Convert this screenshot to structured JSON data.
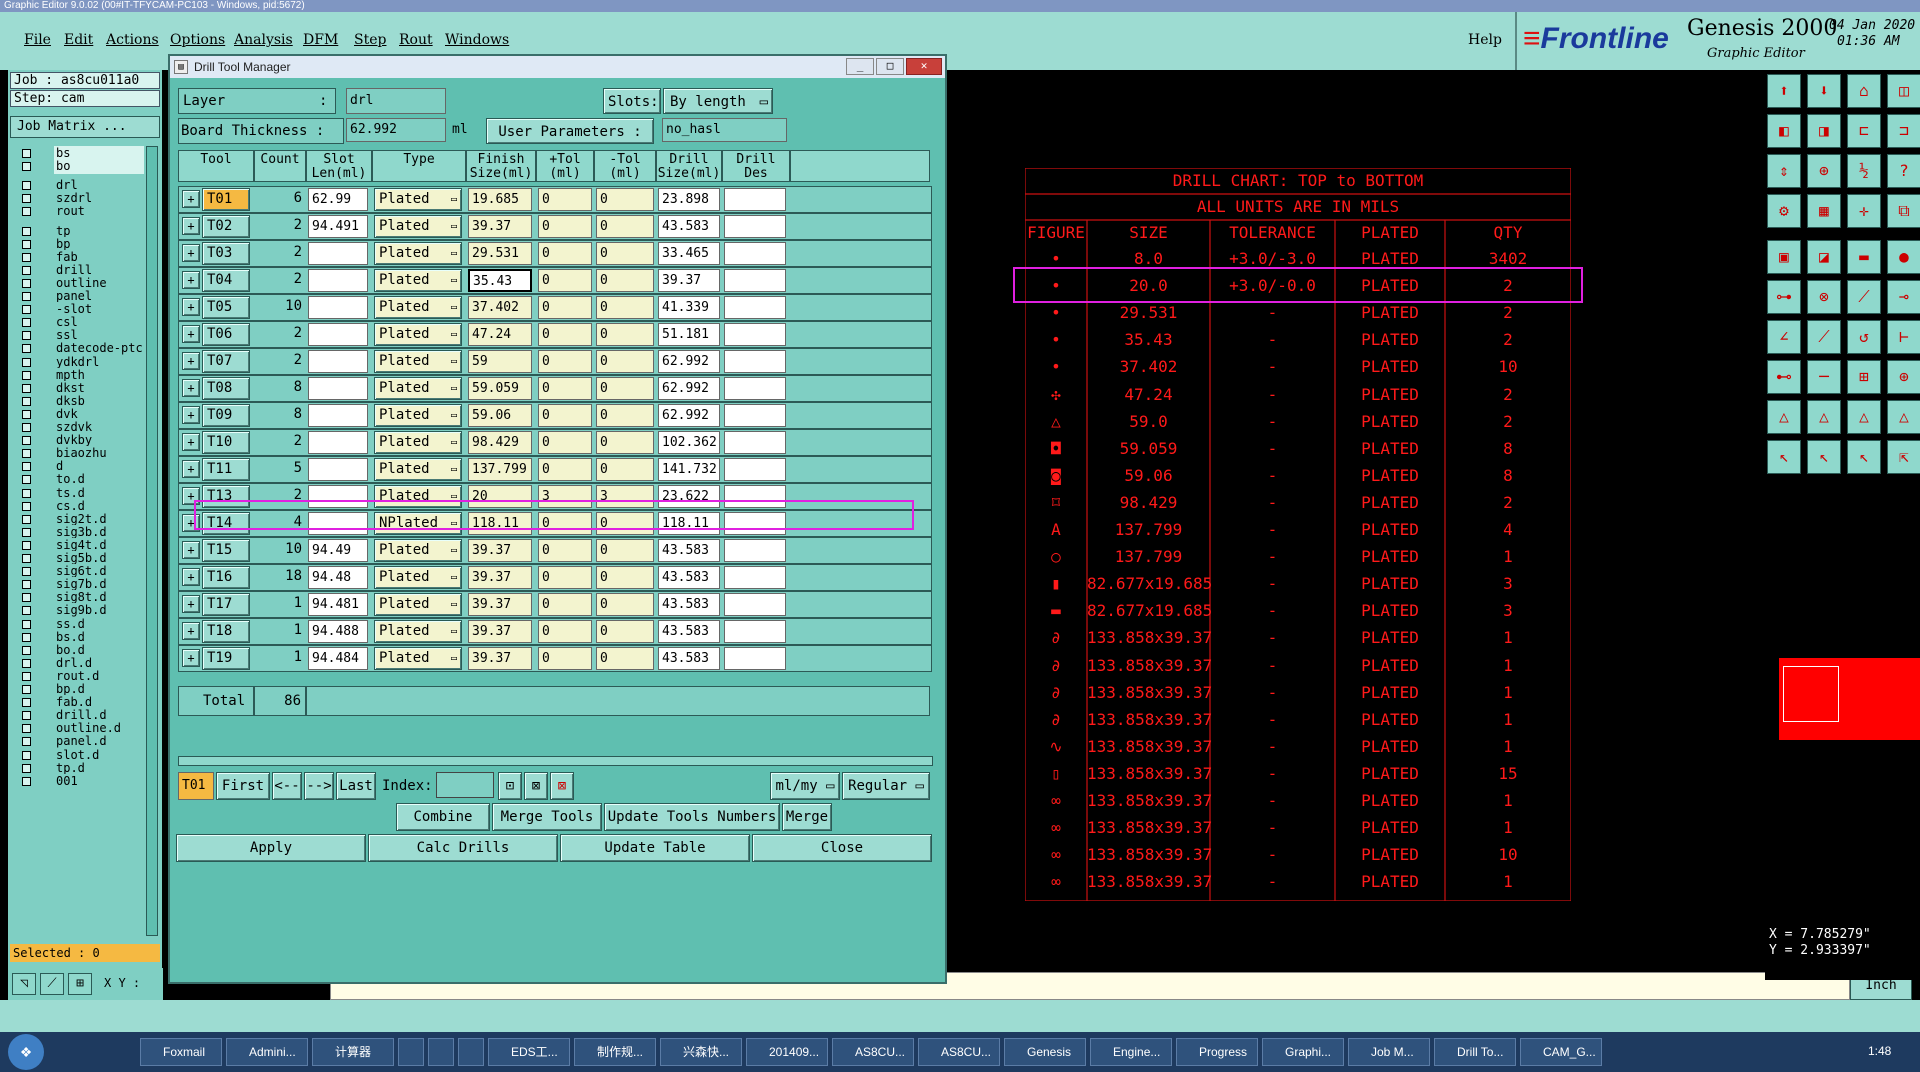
{
  "os_title": "Graphic Editor 9.0.02 (00#IT-TFYCAM-PC103 - Windows, pid:5672)",
  "menu": [
    "File",
    "Edit",
    "Actions",
    "Options",
    "Analysis",
    "DFM",
    "Step",
    "Rout",
    "Windows"
  ],
  "help": "Help",
  "brand": {
    "logo": "Frontline",
    "product": "Genesis 2000",
    "subtitle": "Graphic Editor",
    "date": "04 Jan 2020",
    "time": "01:36 AM"
  },
  "job": {
    "job": "Job : as8cu011a0",
    "step": "Step: cam",
    "matrix": "Job Matrix ..."
  },
  "layers": [
    "bs",
    "bo",
    "drl",
    "szdrl",
    "rout",
    "tp",
    "bp",
    "fab",
    "drill",
    "outline",
    "panel",
    "-slot",
    "csl",
    "ssl",
    "datecode-ptc",
    "ydkdrl",
    "mpth",
    "dkst",
    "dksb",
    "dvk",
    "szdvk",
    "dvkby",
    "biaozhu",
    "d",
    "to.d",
    "ts.d",
    "cs.d",
    "sig2t.d",
    "sig3b.d",
    "sig4t.d",
    "sig5b.d",
    "sig6t.d",
    "sig7b.d",
    "sig8t.d",
    "sig9b.d",
    "ss.d",
    "bs.d",
    "bo.d",
    "drl.d",
    "rout.d",
    "bp.d",
    "fab.d",
    "drill.d",
    "outline.d",
    "panel.d",
    "slot.d",
    "tp.d",
    "001"
  ],
  "selected": "Selected : 0",
  "xy_label": "X Y :",
  "dialog": {
    "title": "Drill Tool Manager",
    "layer_label": "Layer",
    "layer_value": "drl",
    "slots_label": "Slots:",
    "slots_value": "By length",
    "thickness_label": "Board Thickness :",
    "thickness_value": "62.992",
    "thickness_unit": "ml",
    "user_params_label": "User Parameters :",
    "user_params_value": "no_hasl",
    "headers": [
      "Tool",
      "Count",
      "Slot\nLen(ml)",
      "Type",
      "Finish\nSize(ml)",
      "+Tol\n(ml)",
      "-Tol\n(ml)",
      "Drill\nSize(ml)",
      "Drill\nDes"
    ],
    "rows": [
      {
        "tool": "T01",
        "count": "6",
        "slot": "62.99",
        "type": "Plated",
        "finish": "19.685",
        "ptol": "0",
        "ntol": "0",
        "drill": "23.898"
      },
      {
        "tool": "T02",
        "count": "2",
        "slot": "94.491",
        "type": "Plated",
        "finish": "39.37",
        "ptol": "0",
        "ntol": "0",
        "drill": "43.583"
      },
      {
        "tool": "T03",
        "count": "2",
        "slot": "",
        "type": "Plated",
        "finish": "29.531",
        "ptol": "0",
        "ntol": "0",
        "drill": "33.465"
      },
      {
        "tool": "T04",
        "count": "2",
        "slot": "",
        "type": "Plated",
        "finish": "35.43",
        "ptol": "0",
        "ntol": "0",
        "drill": "39.37"
      },
      {
        "tool": "T05",
        "count": "10",
        "slot": "",
        "type": "Plated",
        "finish": "37.402",
        "ptol": "0",
        "ntol": "0",
        "drill": "41.339"
      },
      {
        "tool": "T06",
        "count": "2",
        "slot": "",
        "type": "Plated",
        "finish": "47.24",
        "ptol": "0",
        "ntol": "0",
        "drill": "51.181"
      },
      {
        "tool": "T07",
        "count": "2",
        "slot": "",
        "type": "Plated",
        "finish": "59",
        "ptol": "0",
        "ntol": "0",
        "drill": "62.992"
      },
      {
        "tool": "T08",
        "count": "8",
        "slot": "",
        "type": "Plated",
        "finish": "59.059",
        "ptol": "0",
        "ntol": "0",
        "drill": "62.992"
      },
      {
        "tool": "T09",
        "count": "8",
        "slot": "",
        "type": "Plated",
        "finish": "59.06",
        "ptol": "0",
        "ntol": "0",
        "drill": "62.992"
      },
      {
        "tool": "T10",
        "count": "2",
        "slot": "",
        "type": "Plated",
        "finish": "98.429",
        "ptol": "0",
        "ntol": "0",
        "drill": "102.362"
      },
      {
        "tool": "T11",
        "count": "5",
        "slot": "",
        "type": "Plated",
        "finish": "137.799",
        "ptol": "0",
        "ntol": "0",
        "drill": "141.732"
      },
      {
        "tool": "T13",
        "count": "2",
        "slot": "",
        "type": "Plated",
        "finish": "20",
        "ptol": "3",
        "ntol": "3",
        "drill": "23.622"
      },
      {
        "tool": "T14",
        "count": "4",
        "slot": "",
        "type": "NPlated",
        "finish": "118.11",
        "ptol": "0",
        "ntol": "0",
        "drill": "118.11"
      },
      {
        "tool": "T15",
        "count": "10",
        "slot": "94.49",
        "type": "Plated",
        "finish": "39.37",
        "ptol": "0",
        "ntol": "0",
        "drill": "43.583"
      },
      {
        "tool": "T16",
        "count": "18",
        "slot": "94.48",
        "type": "Plated",
        "finish": "39.37",
        "ptol": "0",
        "ntol": "0",
        "drill": "43.583"
      },
      {
        "tool": "T17",
        "count": "1",
        "slot": "94.481",
        "type": "Plated",
        "finish": "39.37",
        "ptol": "0",
        "ntol": "0",
        "drill": "43.583"
      },
      {
        "tool": "T18",
        "count": "1",
        "slot": "94.488",
        "type": "Plated",
        "finish": "39.37",
        "ptol": "0",
        "ntol": "0",
        "drill": "43.583"
      },
      {
        "tool": "T19",
        "count": "1",
        "slot": "94.484",
        "type": "Plated",
        "finish": "39.37",
        "ptol": "0",
        "ntol": "0",
        "drill": "43.583"
      }
    ],
    "total_label": "Total",
    "total_value": "86",
    "nav": {
      "current": "T01",
      "first": "First",
      "prev": "<--",
      "next": "-->",
      "last": "Last",
      "index": "Index:",
      "units": "ml/my",
      "mode": "Regular"
    },
    "actions": {
      "combine": "Combine Tools",
      "merge_label": "Merge Tools :",
      "update_numbers": "Update Tools Numbers",
      "merge": "Merge"
    },
    "bottom": {
      "apply": "Apply",
      "calc": "Calc Drills",
      "update": "Update Table",
      "close": "Close"
    }
  },
  "chart": {
    "title1": "DRILL CHART: TOP to BOTTOM",
    "title2": "ALL UNITS ARE IN MILS",
    "headers": [
      "FIGURE",
      "SIZE",
      "TOLERANCE",
      "PLATED",
      "QTY"
    ],
    "rows": [
      [
        "•",
        "8.0",
        "+3.0/-3.0",
        "PLATED",
        "3402"
      ],
      [
        "•",
        "20.0",
        "+3.0/-0.0",
        "PLATED",
        "2"
      ],
      [
        "•",
        "29.531",
        "-",
        "PLATED",
        "2"
      ],
      [
        "•",
        "35.43",
        "-",
        "PLATED",
        "2"
      ],
      [
        "•",
        "37.402",
        "-",
        "PLATED",
        "10"
      ],
      [
        "✣",
        "47.24",
        "-",
        "PLATED",
        "2"
      ],
      [
        "△",
        "59.0",
        "-",
        "PLATED",
        "2"
      ],
      [
        "◘",
        "59.059",
        "-",
        "PLATED",
        "8"
      ],
      [
        "◙",
        "59.06",
        "-",
        "PLATED",
        "8"
      ],
      [
        "⌑",
        "98.429",
        "-",
        "PLATED",
        "2"
      ],
      [
        "A",
        "137.799",
        "-",
        "PLATED",
        "4"
      ],
      [
        "○",
        "137.799",
        "-",
        "PLATED",
        "1"
      ],
      [
        "▮",
        "82.677x19.685",
        "-",
        "PLATED",
        "3"
      ],
      [
        "▬",
        "82.677x19.685",
        "-",
        "PLATED",
        "3"
      ],
      [
        "∂",
        "133.858x39.37",
        "-",
        "PLATED",
        "1"
      ],
      [
        "∂",
        "133.858x39.37",
        "-",
        "PLATED",
        "1"
      ],
      [
        "∂",
        "133.858x39.37",
        "-",
        "PLATED",
        "1"
      ],
      [
        "∂",
        "133.858x39.37",
        "-",
        "PLATED",
        "1"
      ],
      [
        "∿",
        "133.858x39.37",
        "-",
        "PLATED",
        "1"
      ],
      [
        "▯",
        "133.858x39.37",
        "-",
        "PLATED",
        "15"
      ],
      [
        "∞",
        "133.858x39.37",
        "-",
        "PLATED",
        "1"
      ],
      [
        "∞",
        "133.858x39.37",
        "-",
        "PLATED",
        "1"
      ],
      [
        "∞",
        "133.858x39.37",
        "-",
        "PLATED",
        "10"
      ],
      [
        "∞",
        "133.858x39.37",
        "-",
        "PLATED",
        "1"
      ]
    ]
  },
  "coords": {
    "x": "X = 7.785279\"",
    "y": "Y = 2.933397\""
  },
  "inch": "Inch",
  "taskbar": [
    "Foxmail",
    "Admini...",
    "计算器",
    "",
    "",
    "",
    "EDS工...",
    "制作规...",
    "兴森快...",
    "201409...",
    "AS8CU...",
    "AS8CU...",
    "Genesis",
    "Engine...",
    "Progress",
    "Graphi...",
    "Job M...",
    "Drill To...",
    "CAM_G..."
  ],
  "clock": "1:48"
}
